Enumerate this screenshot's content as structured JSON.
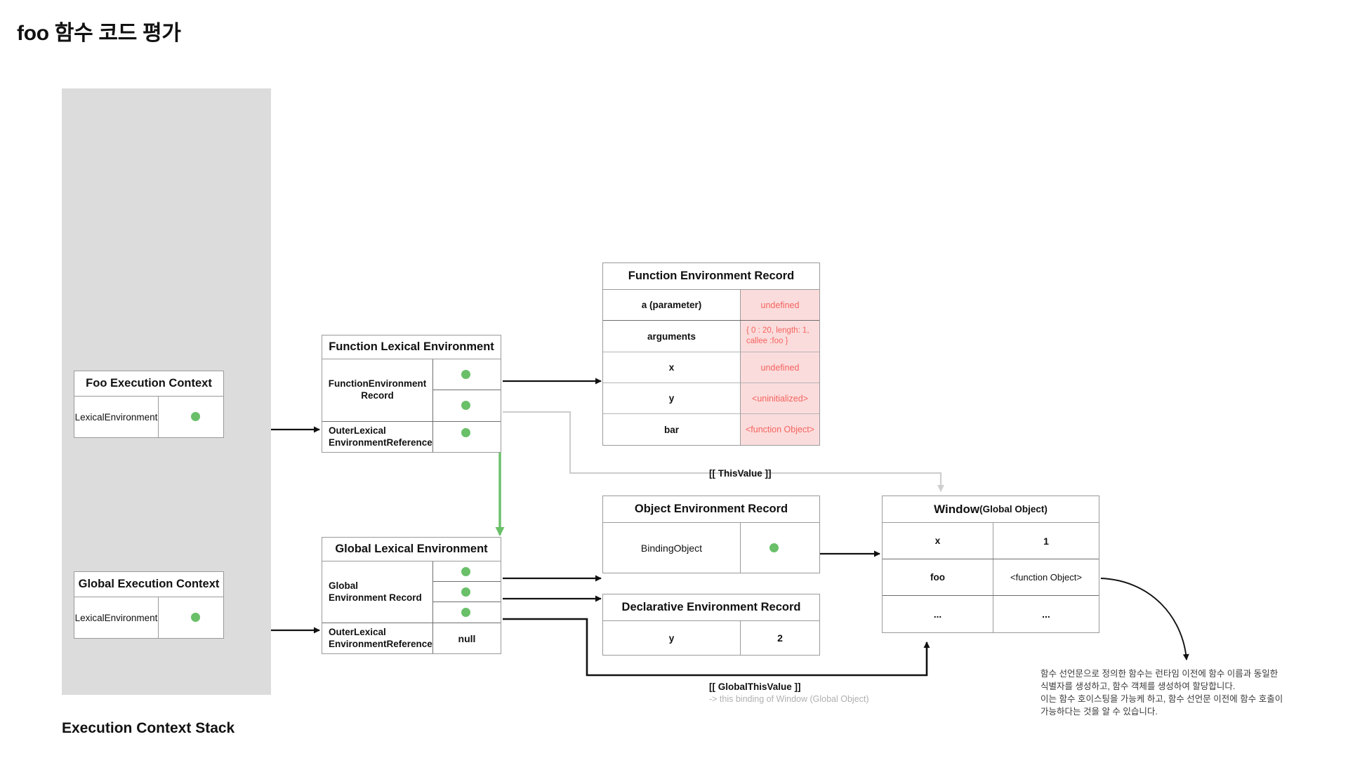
{
  "page": {
    "title": "foo 함수 코드 평가",
    "stack_caption": "Execution Context Stack"
  },
  "execution_contexts": [
    {
      "title": "Foo Execution Context",
      "field": "LexicalEnvironment"
    },
    {
      "title": "Global Execution Context",
      "field": "LexicalEnvironment"
    }
  ],
  "function_lexical_environment": {
    "title": "Function Lexical Environment",
    "record_label": "FunctionEnvironment\nRecord",
    "outer_label": "OuterLexical\nEnvironmentReference",
    "outer_value": ""
  },
  "global_lexical_environment": {
    "title": "Global Lexical Environment",
    "record_label": "Global\nEnvironment Record",
    "outer_label": "OuterLexical\nEnvironmentReference",
    "outer_value": "null"
  },
  "function_environment_record": {
    "title": "Function Environment Record",
    "rows": [
      {
        "key": "a (parameter)",
        "value": "undefined",
        "style": "red"
      },
      {
        "key": "arguments",
        "value": "{ 0 : 20, length: 1, callee :foo }",
        "style": "red-multiline"
      },
      {
        "key": "x",
        "value": "undefined",
        "style": "red"
      },
      {
        "key": "y",
        "value": "<uninitialized>",
        "style": "red"
      },
      {
        "key": "bar",
        "value": "<function Object>",
        "style": "red"
      }
    ]
  },
  "object_environment_record": {
    "title": "Object Environment Record",
    "rows": [
      {
        "key": "BindingObject",
        "value": ""
      }
    ]
  },
  "declarative_environment_record": {
    "title": "Declarative Environment Record",
    "rows": [
      {
        "key": "y",
        "value": "2"
      }
    ]
  },
  "window_object": {
    "title": "Window",
    "title_suffix": "(Global Object)",
    "rows": [
      {
        "key": "x",
        "value": "1"
      },
      {
        "key": "foo",
        "value": "<function Object>"
      },
      {
        "key": "...",
        "value": "..."
      }
    ]
  },
  "edges": {
    "this_value": "[[ ThisValue ]]",
    "global_this_value": "[[ GlobalThisValue ]]",
    "global_this_value_sub": "-> this binding of Window (Global Object)"
  },
  "note": {
    "line1": "함수 선언문으로 정의한 함수는 런타임 이전에 함수 이름과 동일한",
    "line2": "식별자를 생성하고, 함수 객체를 생성하여 할당합니다.",
    "line3": "이는 함수 호이스팅을 가능케 하고, 함수 선언문 이전에 함수 호출이",
    "line4": "가능하다는 것을 알 수 있습니다."
  },
  "colors": {
    "stack_bg": "#dcdcdc",
    "pointer_dot": "#6abf69",
    "red_value_bg": "#fbdcdc",
    "red_value_text": "#f4645f",
    "border": "#9a9a9a",
    "wire_black": "#111111",
    "wire_gray": "#cfcfcf",
    "wire_green": "#6abf69"
  }
}
